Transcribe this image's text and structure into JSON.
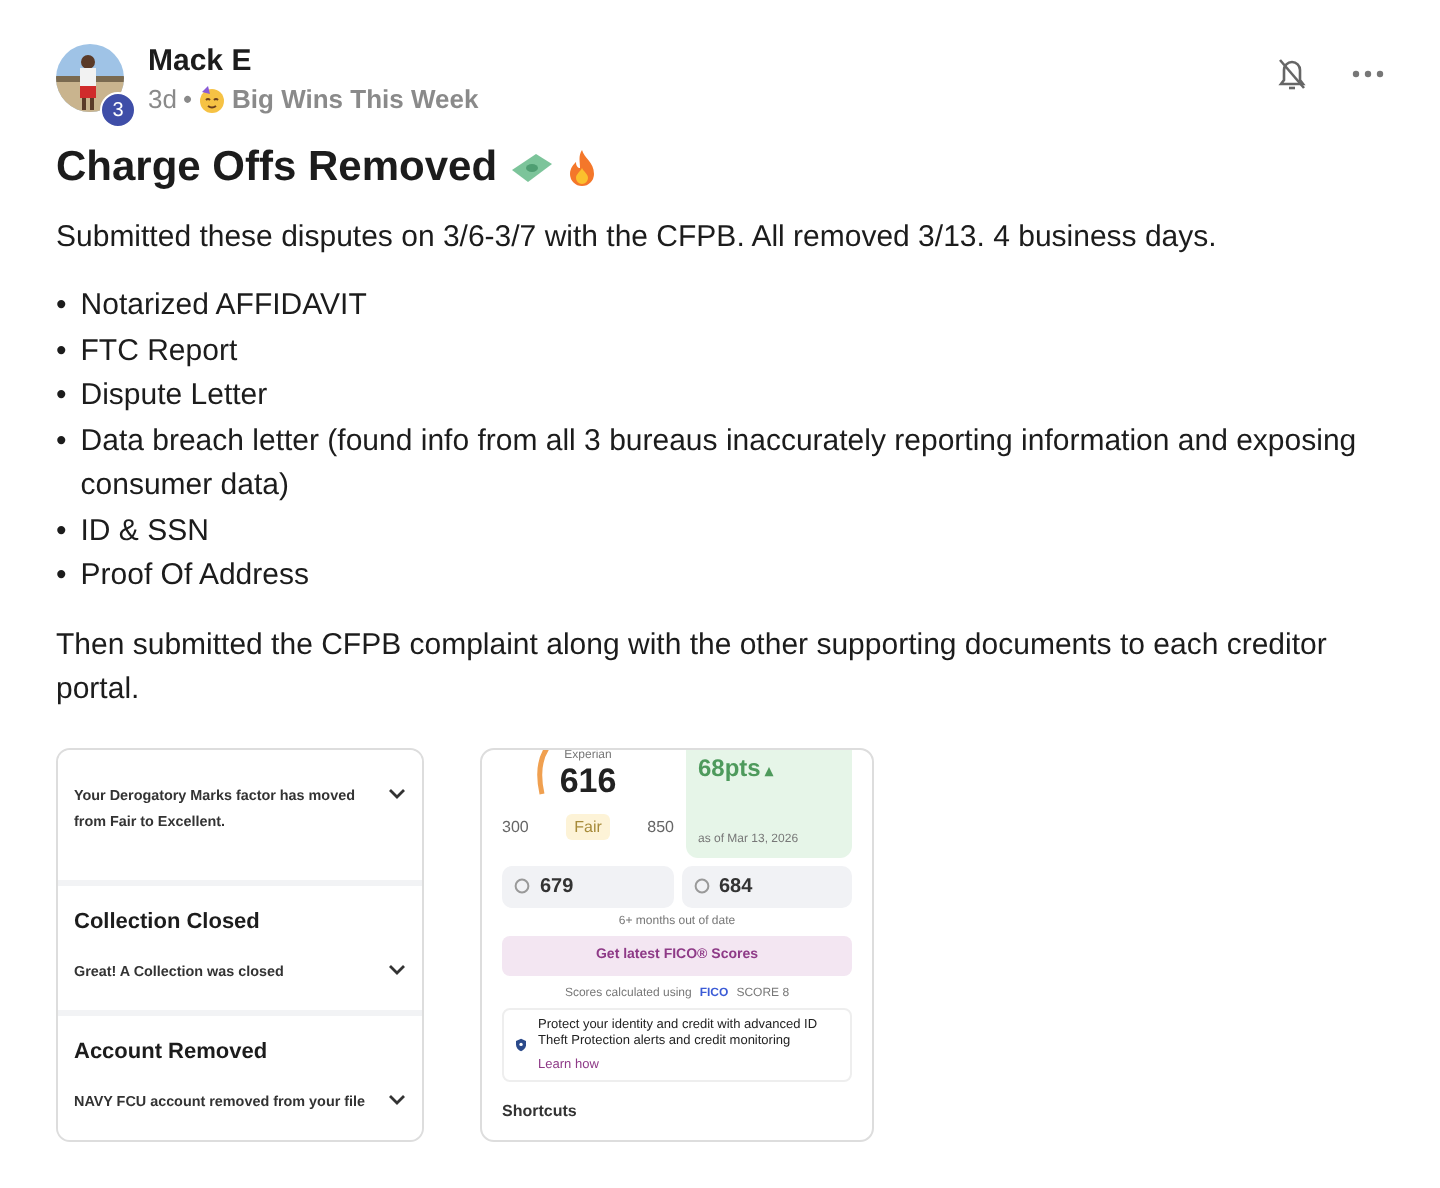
{
  "post": {
    "author": "Mack E",
    "level_badge": "3",
    "age": "3d",
    "separator": "•",
    "group": "Big Wins This Week",
    "title": "Charge Offs Removed",
    "intro": "Submitted these disputes on 3/6-3/7 with the CFPB. All removed 3/13. 4 business days.",
    "bullets": [
      {
        "marker": "•",
        "text": "Notarized AFFIDAVIT"
      },
      {
        "marker": "•",
        "text": "FTC Report"
      },
      {
        "marker": "•",
        "text": "Dispute Letter"
      },
      {
        "marker": "•",
        "text": "Data breach letter (found info from all 3 bureaus inaccurately reporting information and exposing consumer data)"
      },
      {
        "marker": "•",
        "text": "ID & SSN"
      },
      {
        "marker": "•",
        "text": "Proof Of Address"
      }
    ],
    "outro": "Then submitted the CFPB complaint along with the other supporting documents to each creditor portal."
  },
  "attachment_1": {
    "cards": [
      {
        "detail": "Your Derogatory Marks factor has moved from Fair to Excellent."
      },
      {
        "heading": "Collection Closed",
        "detail": "Great! A Collection was closed"
      },
      {
        "heading": "Account Removed",
        "detail": "NAVY FCU account removed from your file"
      }
    ]
  },
  "attachment_2": {
    "gauge_label": "Experian",
    "score": "616",
    "min": "300",
    "rating": "Fair",
    "max": "850",
    "change": "68pts",
    "change_arrow": "▴",
    "as_of": "as of Mar 13, 2026",
    "other_scores": [
      "679",
      "684"
    ],
    "stale_note": "6+ months out of date",
    "cta": "Get latest FICO® Scores",
    "calc_label": "Scores calculated using",
    "fico_brand": "FICO",
    "fico_version": "SCORE 8",
    "protect_text": "Protect your identity and credit with advanced ID Theft Protection alerts and credit monitoring",
    "learn_link": "Learn how",
    "shortcuts": "Shortcuts"
  }
}
